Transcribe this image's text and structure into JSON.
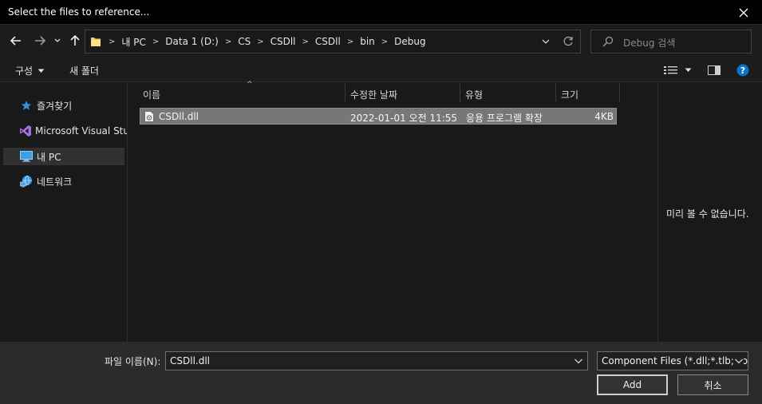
{
  "window": {
    "title": "Select the files to reference..."
  },
  "address": {
    "crumbs": [
      "내 PC",
      "Data 1 (D:)",
      "CS",
      "CSDll",
      "CSDll",
      "bin",
      "Debug"
    ]
  },
  "search": {
    "placeholder": "Debug 검색"
  },
  "toolbar": {
    "organize": "구성",
    "new_folder": "새 폴더"
  },
  "sidebar": {
    "items": [
      {
        "label": "즐겨찾기",
        "icon": "star-icon"
      },
      {
        "label": "Microsoft Visual Studio",
        "icon": "visual-studio-icon"
      },
      {
        "label": "내 PC",
        "icon": "pc-icon",
        "selected": true
      },
      {
        "label": "네트워크",
        "icon": "network-icon"
      }
    ]
  },
  "filelist": {
    "columns": [
      "이름",
      "수정한 날짜",
      "유형",
      "크기"
    ],
    "rows": [
      {
        "name": "CSDll.dll",
        "modified": "2022-01-01 오전 11:55",
        "type": "응용 프로그램 확장",
        "size": "4KB",
        "selected": true
      }
    ]
  },
  "preview": {
    "message": "미리 볼 수 없습니다."
  },
  "footer": {
    "filename_label": "파일 이름(N):",
    "filename_value": "CSDll.dll",
    "filetype_value": "Component Files (*.dll;*.tlb;*.olb;*.ocx;*.exe;*.manifest)",
    "add_label": "Add",
    "cancel_label": "취소"
  },
  "colors": {
    "background": "#191919",
    "titlebar": "#000000",
    "selection": "#777777",
    "accent_help": "#0a72c9"
  }
}
